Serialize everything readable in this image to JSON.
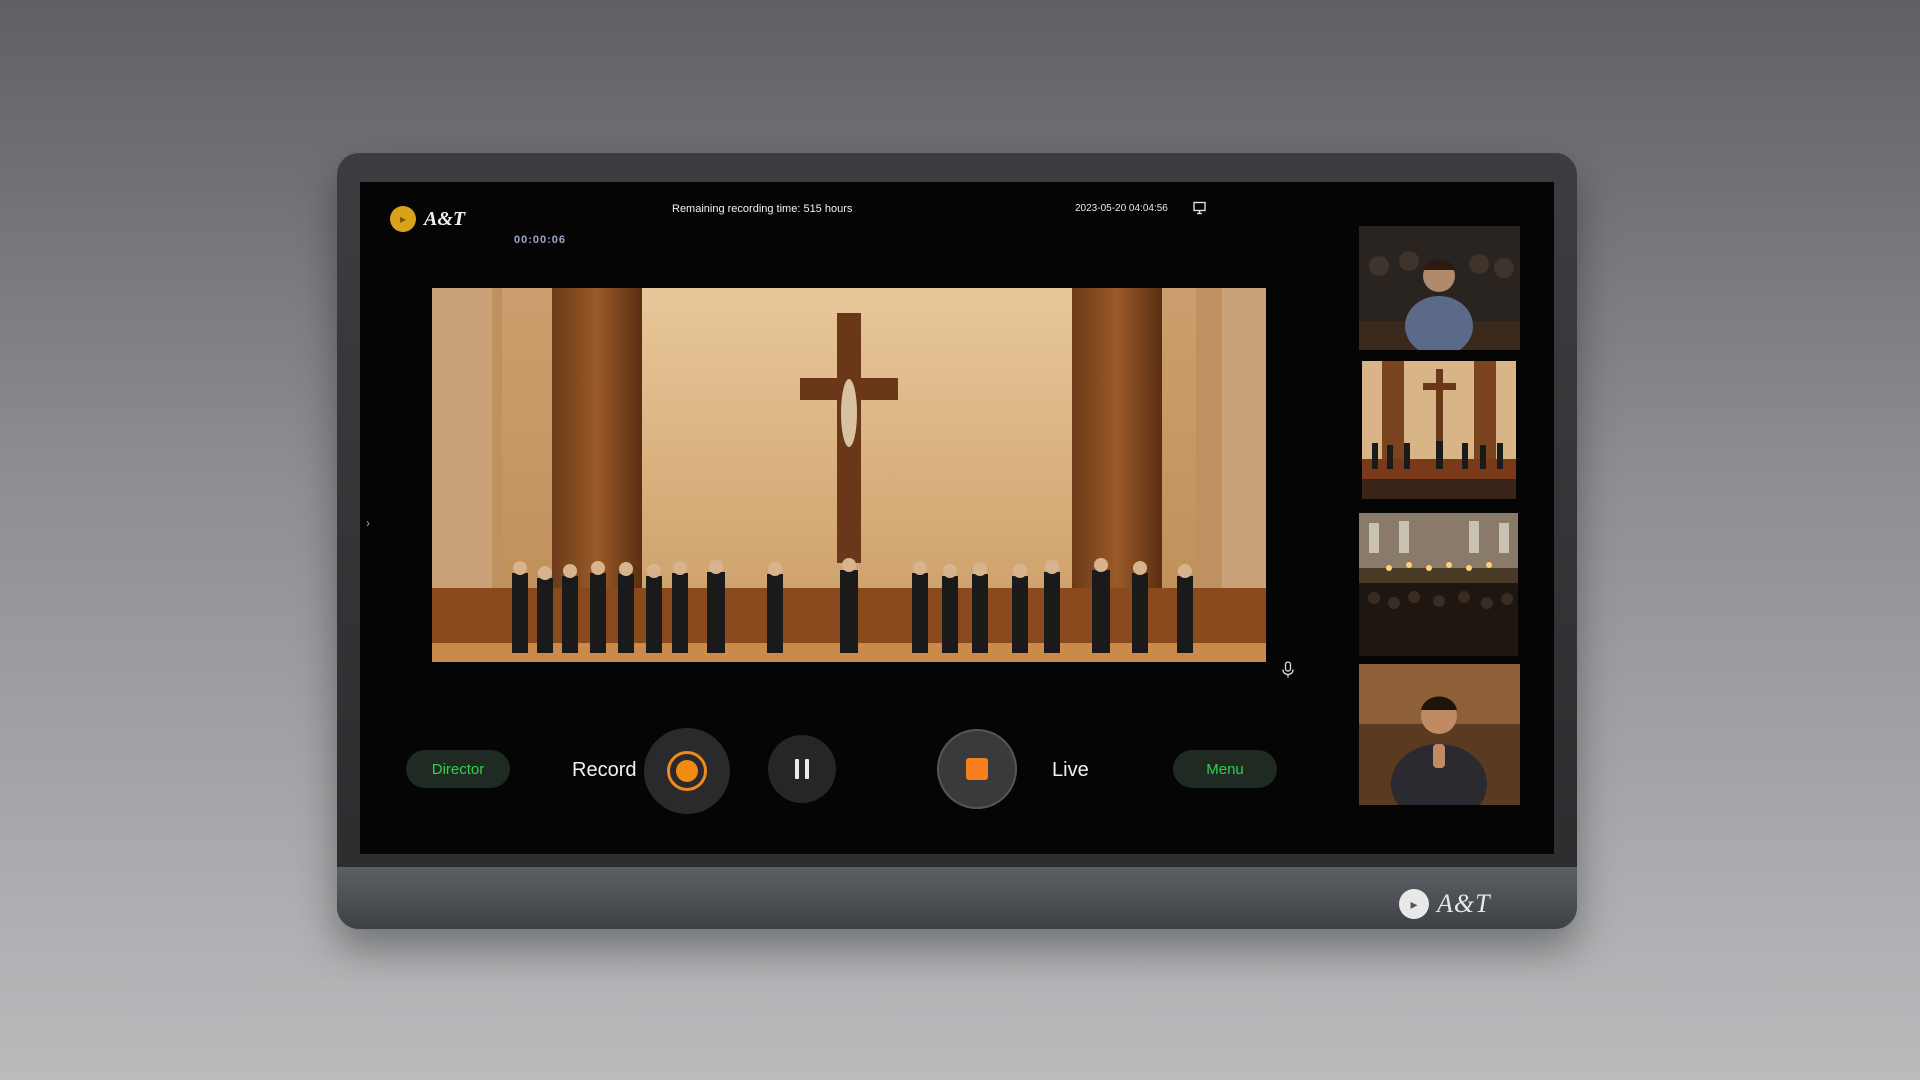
{
  "device": {
    "brand": "A&T",
    "bezel_brand": "A&T"
  },
  "status": {
    "remaining_time": "Remaining recording time: 515 hours",
    "datetime": "2023-05-20 04:04:56",
    "elapsed_timer": "00:00:06"
  },
  "controls": {
    "director_label": "Director",
    "record_label": "Record",
    "live_label": "Live",
    "menu_label": "Menu"
  },
  "colors": {
    "accent_orange": "#f28b12",
    "accent_green": "#2fd24a",
    "brand_gold": "#d9a21b"
  },
  "icons": {
    "cast": "cast-icon",
    "mic": "microphone-icon",
    "record": "record-icon",
    "pause": "pause-icon",
    "stop": "stop-icon"
  }
}
